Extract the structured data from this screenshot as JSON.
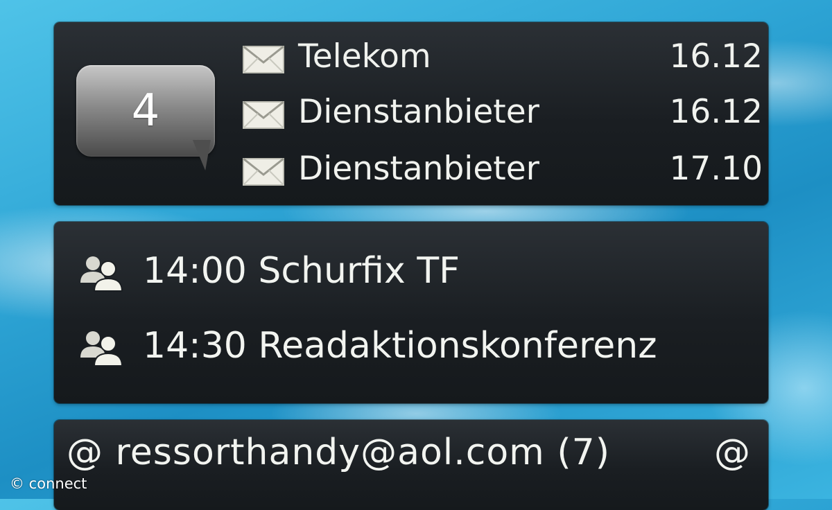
{
  "messages_widget": {
    "unread_count": "4",
    "items": [
      {
        "sender": "Telekom",
        "date": "16.12",
        "icon": "envelope-icon"
      },
      {
        "sender": "Dienstanbieter",
        "date": "16.12",
        "icon": "envelope-icon"
      },
      {
        "sender": "Dienstanbieter",
        "date": "17.10",
        "icon": "envelope-icon"
      }
    ]
  },
  "calendar_widget": {
    "items": [
      {
        "text": "14:00 Schurfix TF",
        "icon": "meeting-people-icon"
      },
      {
        "text": "14:30 Readaktionskonferenz",
        "icon": "meeting-people-icon"
      }
    ]
  },
  "email_widget": {
    "account_line": "@ ressorthandy@aol.com  (7)",
    "trailing_at": "@"
  },
  "watermark": "© connect",
  "colors": {
    "panel_bg": "#1a1e22",
    "text": "#f0f2ee",
    "bubble_top": "#c7c7c7",
    "bubble_bottom": "#4a4a4a",
    "background_water": "#2fa6d6"
  }
}
